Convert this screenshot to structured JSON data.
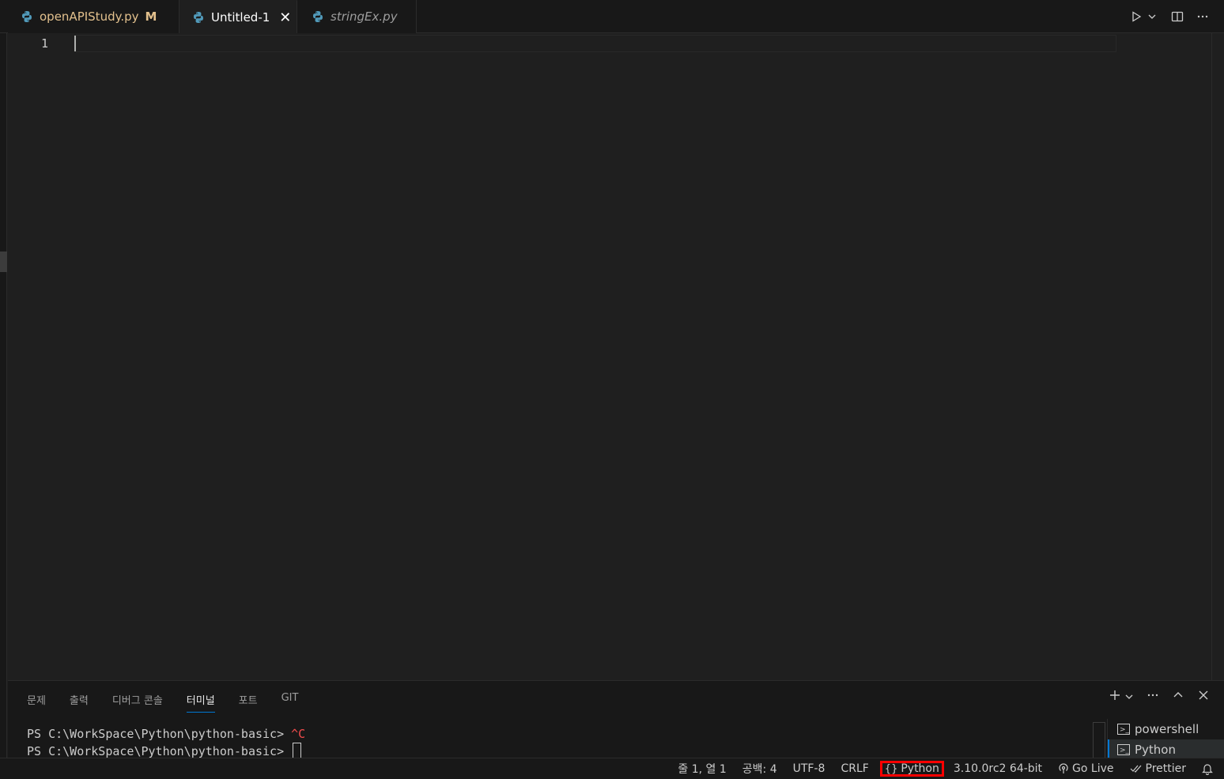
{
  "tabs": [
    {
      "label": "openAPIStudy.py",
      "badge": "M",
      "icon": "python-icon"
    },
    {
      "label": "Untitled-1",
      "close": "✕",
      "icon": "python-icon"
    },
    {
      "label": "stringEx.py",
      "icon": "python-icon"
    }
  ],
  "editor": {
    "line_number": "1"
  },
  "panel": {
    "tabs": [
      "문제",
      "출력",
      "디버그 콘솔",
      "터미널",
      "포트",
      "GIT"
    ],
    "active_tab": "터미널",
    "terminal_lines": [
      {
        "prompt": "PS C:\\WorkSpace\\Python\\python-basic> ",
        "extra": "^C"
      },
      {
        "prompt": "PS C:\\WorkSpace\\Python\\python-basic> ",
        "extra": ""
      }
    ],
    "terminals": [
      "powershell",
      "Python"
    ]
  },
  "statusbar": {
    "position": "줄 1, 열 1",
    "spaces": "공백: 4",
    "encoding": "UTF-8",
    "eol": "CRLF",
    "language": "Python",
    "interpreter": "3.10.0rc2 64-bit",
    "golive": "Go Live",
    "prettier": "Prettier"
  },
  "colors": {
    "accent": "#0078d4",
    "highlight_box": "#ff0000",
    "modified": "#e2c08d"
  }
}
